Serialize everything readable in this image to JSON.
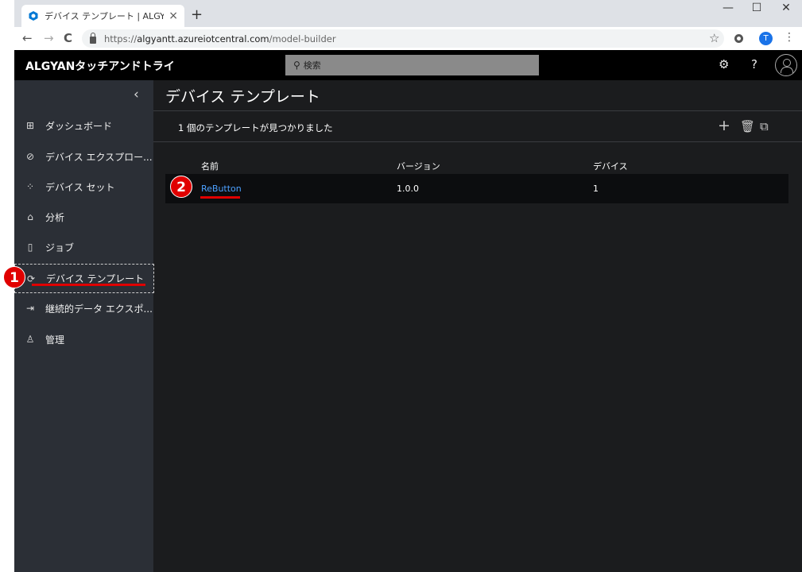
{
  "browser": {
    "tab_title": "デバイス テンプレート | ALGYANタッチ",
    "tab_close": "×",
    "new_tab": "+",
    "minimize": "—",
    "maximize": "☐",
    "close": "✕",
    "back": "←",
    "forward": "→",
    "reload": "C",
    "url_prefix": "https://",
    "url_host": "algyantt.azureiotcentral.com",
    "url_path": "/model-builder",
    "profile_initial": "T"
  },
  "header": {
    "brand": "ALGYANタッチアンドトライ",
    "search_placeholder": "検索"
  },
  "sidebar": {
    "items": [
      {
        "label": "ダッシュボード",
        "icon": "dashboard-icon",
        "glyph": "⊞"
      },
      {
        "label": "デバイス エクスプロー...",
        "icon": "device-explorer-icon",
        "glyph": "⊘"
      },
      {
        "label": "デバイス セット",
        "icon": "device-set-icon",
        "glyph": "⁘"
      },
      {
        "label": "分析",
        "icon": "analytics-icon",
        "glyph": "⌂"
      },
      {
        "label": "ジョブ",
        "icon": "jobs-icon",
        "glyph": "▯"
      },
      {
        "label": "デバイス テンプレート",
        "icon": "device-template-icon",
        "glyph": "⟳"
      },
      {
        "label": "継続的データ エクスポ...",
        "icon": "export-icon",
        "glyph": "⇥"
      },
      {
        "label": "管理",
        "icon": "admin-icon",
        "glyph": "♙"
      }
    ]
  },
  "annotations": {
    "marker1": "1",
    "marker2": "2"
  },
  "main": {
    "title": "デバイス テンプレート",
    "count_text": "1 個のテンプレートが見つかりました",
    "columns": [
      "名前",
      "バージョン",
      "デバイス"
    ],
    "rows": [
      {
        "name": "ReButton",
        "version": "1.0.0",
        "devices": "1"
      }
    ]
  },
  "colors": {
    "accent_link": "#4ca0ff",
    "annotation_red": "#e00000",
    "sidebar_bg": "#2b2f36",
    "header_bg": "#000000"
  }
}
